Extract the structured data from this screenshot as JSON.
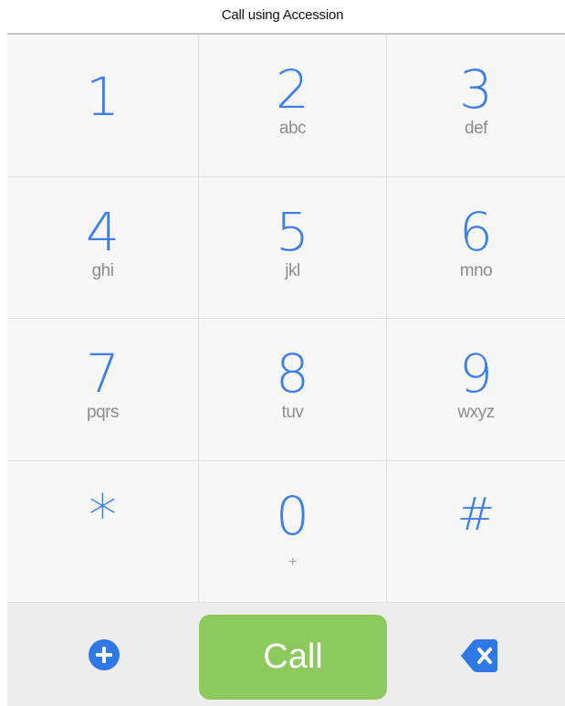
{
  "title": "Call using Accession",
  "keys": [
    {
      "digit": "1",
      "letters": ""
    },
    {
      "digit": "2",
      "letters": "abc"
    },
    {
      "digit": "3",
      "letters": "def"
    },
    {
      "digit": "4",
      "letters": "ghi"
    },
    {
      "digit": "5",
      "letters": "jkl"
    },
    {
      "digit": "6",
      "letters": "mno"
    },
    {
      "digit": "7",
      "letters": "pqrs"
    },
    {
      "digit": "8",
      "letters": "tuv"
    },
    {
      "digit": "9",
      "letters": "wxyz"
    },
    {
      "digit": "*",
      "letters": ""
    },
    {
      "digit": "0",
      "letters": "+"
    },
    {
      "digit": "#",
      "letters": ""
    }
  ],
  "actions": {
    "add_icon": "plus-circle-icon",
    "call_label": "Call",
    "delete_icon": "backspace-icon"
  },
  "colors": {
    "digit": "#3d7fe6",
    "call_button": "#8dca5d",
    "icon_blue": "#2e79e6"
  }
}
